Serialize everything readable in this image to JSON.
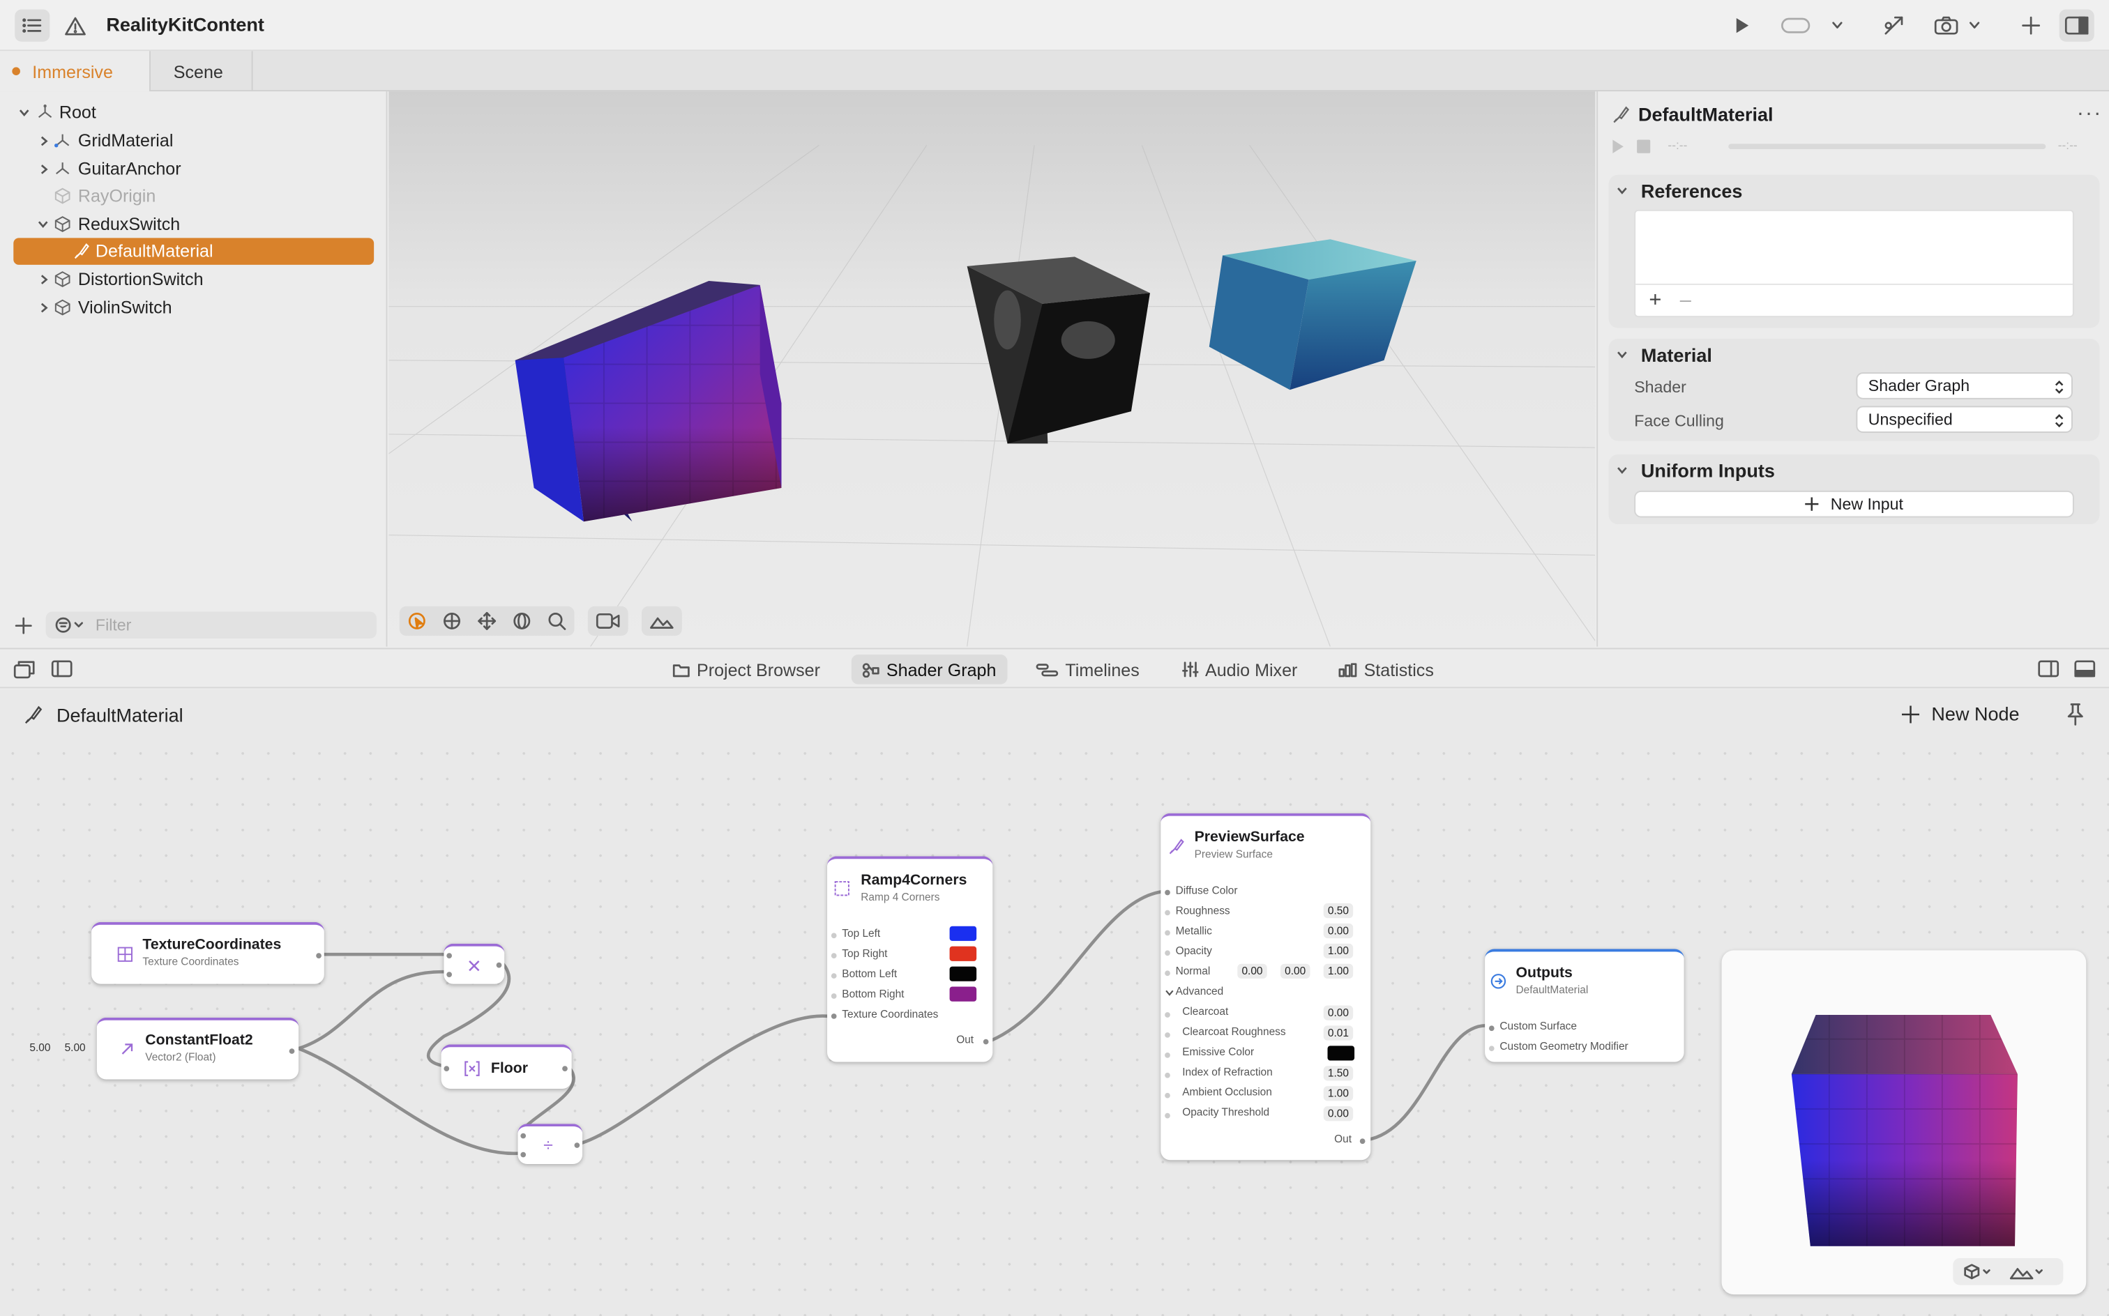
{
  "app": {
    "title": "RealityKitContent"
  },
  "doc_tabs": [
    {
      "label": "Immersive"
    },
    {
      "label": "Scene"
    }
  ],
  "hierarchy": {
    "items": [
      {
        "label": "Root"
      },
      {
        "label": "GridMaterial"
      },
      {
        "label": "GuitarAnchor"
      },
      {
        "label": "RayOrigin"
      },
      {
        "label": "ReduxSwitch"
      },
      {
        "label": "DefaultMaterial"
      },
      {
        "label": "DistortionSwitch"
      },
      {
        "label": "ViolinSwitch"
      }
    ],
    "filter_placeholder": "Filter"
  },
  "inspector": {
    "title": "DefaultMaterial",
    "time_start": "--:--",
    "time_end": "--:--",
    "references_header": "References",
    "material_header": "Material",
    "shader_label": "Shader",
    "shader_value": "Shader Graph",
    "face_culling_label": "Face Culling",
    "face_culling_value": "Unspecified",
    "uniform_header": "Uniform Inputs",
    "new_input_label": "New Input"
  },
  "bottom_tabs": [
    {
      "label": "Project Browser"
    },
    {
      "label": "Shader Graph"
    },
    {
      "label": "Timelines"
    },
    {
      "label": "Audio Mixer"
    },
    {
      "label": "Statistics"
    }
  ],
  "graph": {
    "material_name": "DefaultMaterial",
    "new_node_label": "New Node",
    "constant_values": [
      "5.00",
      "5.00"
    ],
    "nodes": {
      "texcoord": {
        "title": "TextureCoordinates",
        "subtitle": "Texture Coordinates"
      },
      "constfloat": {
        "title": "ConstantFloat2",
        "subtitle": "Vector2 (Float)"
      },
      "floor": {
        "title": "Floor"
      },
      "ramp": {
        "title": "Ramp4Corners",
        "subtitle": "Ramp 4 Corners",
        "inputs": [
          "Top Left",
          "Top Right",
          "Bottom Left",
          "Bottom Right",
          "Texture Coordinates"
        ],
        "colors": [
          "#1a2ff0",
          "#e0331f",
          "#050505",
          "#8a1f8c"
        ],
        "out": "Out"
      },
      "preview_surface": {
        "title": "PreviewSurface",
        "subtitle": "Preview Surface",
        "diffuse": "Diffuse Color",
        "props": [
          {
            "label": "Roughness",
            "value": "0.50"
          },
          {
            "label": "Metallic",
            "value": "0.00"
          },
          {
            "label": "Opacity",
            "value": "1.00"
          }
        ],
        "normal_label": "Normal",
        "normal_values": [
          "0.00",
          "0.00",
          "1.00"
        ],
        "advanced": "Advanced",
        "adv_props": [
          {
            "label": "Clearcoat",
            "value": "0.00"
          },
          {
            "label": "Clearcoat Roughness",
            "value": "0.01"
          },
          {
            "label": "Emissive Color",
            "value": ""
          },
          {
            "label": "Index of Refraction",
            "value": "1.50"
          },
          {
            "label": "Ambient Occlusion",
            "value": "1.00"
          },
          {
            "label": "Opacity Threshold",
            "value": "0.00"
          }
        ],
        "out": "Out"
      },
      "outputs": {
        "title": "Outputs",
        "subtitle": "DefaultMaterial",
        "inputs": [
          "Custom Surface",
          "Custom Geometry Modifier"
        ]
      }
    }
  },
  "colors": {
    "accent": "#d9822b",
    "node_border": "#9b6bd6",
    "outputs_border": "#3a7be0"
  }
}
